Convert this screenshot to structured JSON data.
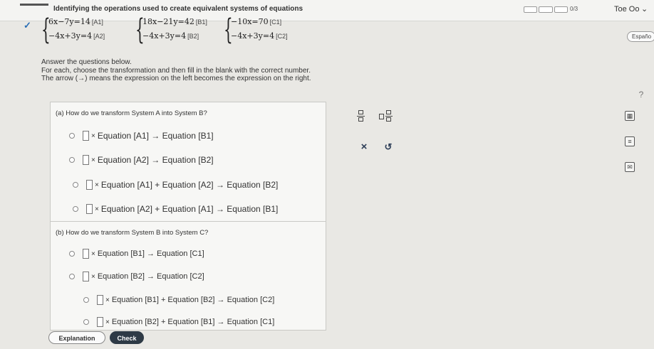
{
  "header": {
    "title": "Identifying the operations used to create equivalent systems of equations",
    "progress_text": "0/3",
    "user_name": "Toe Oo"
  },
  "systems": [
    {
      "eq1": "6x−7y=14",
      "eq1_label": "[A1]",
      "eq2": "−4x+3y=4",
      "eq2_label": "[A2]"
    },
    {
      "eq1": "18x−21y=42",
      "eq1_label": "[B1]",
      "eq2": "−4x+3y=4",
      "eq2_label": "[B2]"
    },
    {
      "eq1": "−10x=70",
      "eq1_label": "[C1]",
      "eq2": "−4x+3y=4",
      "eq2_label": "[C2]"
    }
  ],
  "language_button": "Españo",
  "instructions": {
    "line1": "Answer the questions below.",
    "line2": "For each, choose the transformation and then fill in the blank with the correct number.",
    "line3": "The arrow (→) means the expression on the left becomes the expression on the right."
  },
  "part_a": {
    "question": "(a)  How do we transform System A into System B?",
    "options": [
      {
        "text": "Equation [A1] → Equation [B1]"
      },
      {
        "text": "Equation [A2] → Equation [B2]"
      },
      {
        "text": "Equation [A1] + Equation [A2] → Equation [B2]"
      },
      {
        "text": "Equation [A2] + Equation [A1] → Equation [B1]"
      }
    ]
  },
  "part_b": {
    "question": "(b)  How do we transform System B into System C?",
    "options": [
      {
        "text": "Equation [B1] → Equation [C1]"
      },
      {
        "text": "Equation [B2] → Equation [C2]"
      },
      {
        "text": "Equation [B1] + Equation [B2] → Equation [C2]"
      },
      {
        "text": "Equation [B2] + Equation [B1] → Equation [C1]"
      }
    ]
  },
  "times_symbol": "×",
  "toolbox": {
    "clear_symbol": "×",
    "undo_symbol": "↺"
  },
  "help_symbol": "?",
  "buttons": {
    "explanation": "Explanation",
    "check": "Check"
  }
}
